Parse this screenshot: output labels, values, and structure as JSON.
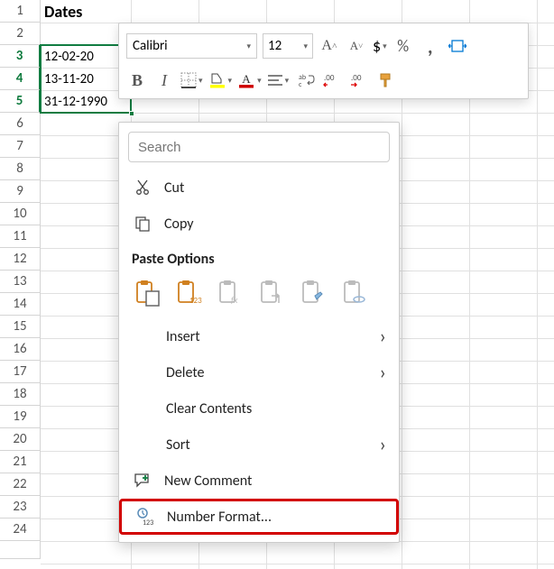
{
  "sheet": {
    "header": "Dates",
    "rows": [
      "12-02-20",
      "13-11-20",
      "31-12-1990"
    ]
  },
  "toolbar": {
    "font": "Calibri",
    "size": "12",
    "bold": "B",
    "italic": "I"
  },
  "search": {
    "placeholder": "Search"
  },
  "menu": {
    "cut": "Cut",
    "copy": "Copy",
    "paste_label": "Paste Options",
    "insert": "Insert",
    "delete": "Delete",
    "clear": "Clear Contents",
    "sort": "Sort",
    "comment": "New Comment",
    "number_format": "Number Format..."
  }
}
